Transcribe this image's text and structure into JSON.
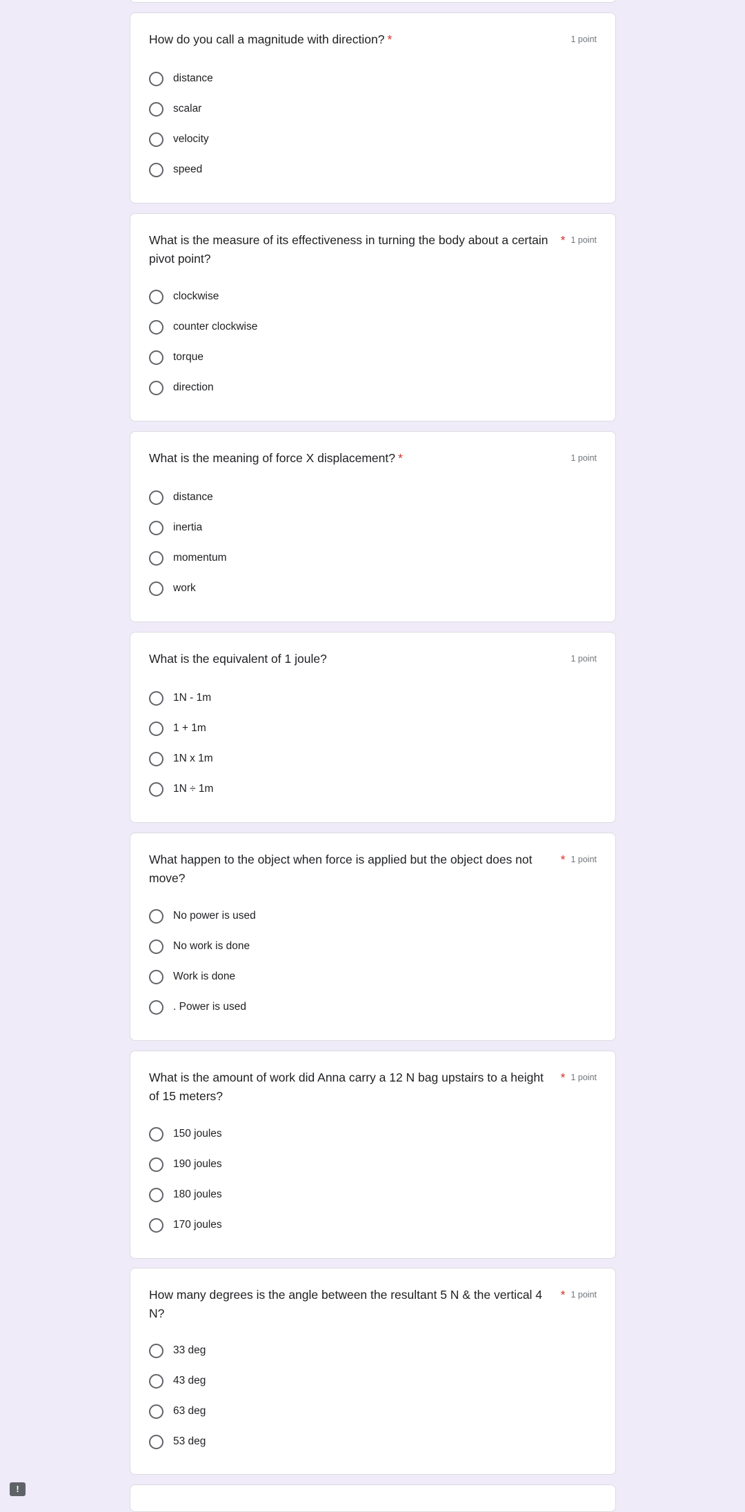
{
  "questions": [
    {
      "title": "How do you call a magnitude with direction?",
      "required_mark": "*",
      "points": "1 point",
      "options": [
        "distance",
        "scalar",
        "velocity",
        "speed"
      ]
    },
    {
      "title": "What is the measure of its effectiveness in turning the body about a certain pivot point?",
      "required_mark": "*",
      "points": "1 point",
      "options": [
        "clockwise",
        "counter clockwise",
        "torque",
        "direction"
      ]
    },
    {
      "title": "What is the meaning of force X displacement?",
      "required_mark": "*",
      "points": "1 point",
      "options": [
        "distance",
        "inertia",
        "momentum",
        "work"
      ]
    },
    {
      "title": "What is the equivalent of 1 joule?",
      "points": "1 point",
      "options": [
        "1N - 1m",
        "1 + 1m",
        "1N x 1m",
        "1N ÷ 1m"
      ]
    },
    {
      "title": "What happen to the object when force is applied but the object does not move?",
      "required_mark": "*",
      "points": "1 point",
      "options": [
        "No power is used",
        "No work is done",
        "Work is done",
        ". Power is used"
      ]
    },
    {
      "title": "What is the amount of work did Anna carry a 12 N bag upstairs to a height of 15 meters?",
      "required_mark": "*",
      "points": "1 point",
      "options": [
        "150 joules",
        "190 joules",
        "180 joules",
        "170 joules"
      ]
    },
    {
      "title": "How many degrees is the angle between the resultant 5 N & the vertical 4 N?",
      "required_mark": "*",
      "points": "1 point",
      "options": [
        "33 deg",
        "43 deg",
        "63 deg",
        "53 deg"
      ]
    }
  ],
  "report_button": {
    "icon": "exclamation-icon",
    "glyph": "!"
  },
  "colors": {
    "page_background": "#f0ebf8",
    "card_border": "#dadce0",
    "required": "#d93025",
    "radio_border": "#5f6368"
  }
}
